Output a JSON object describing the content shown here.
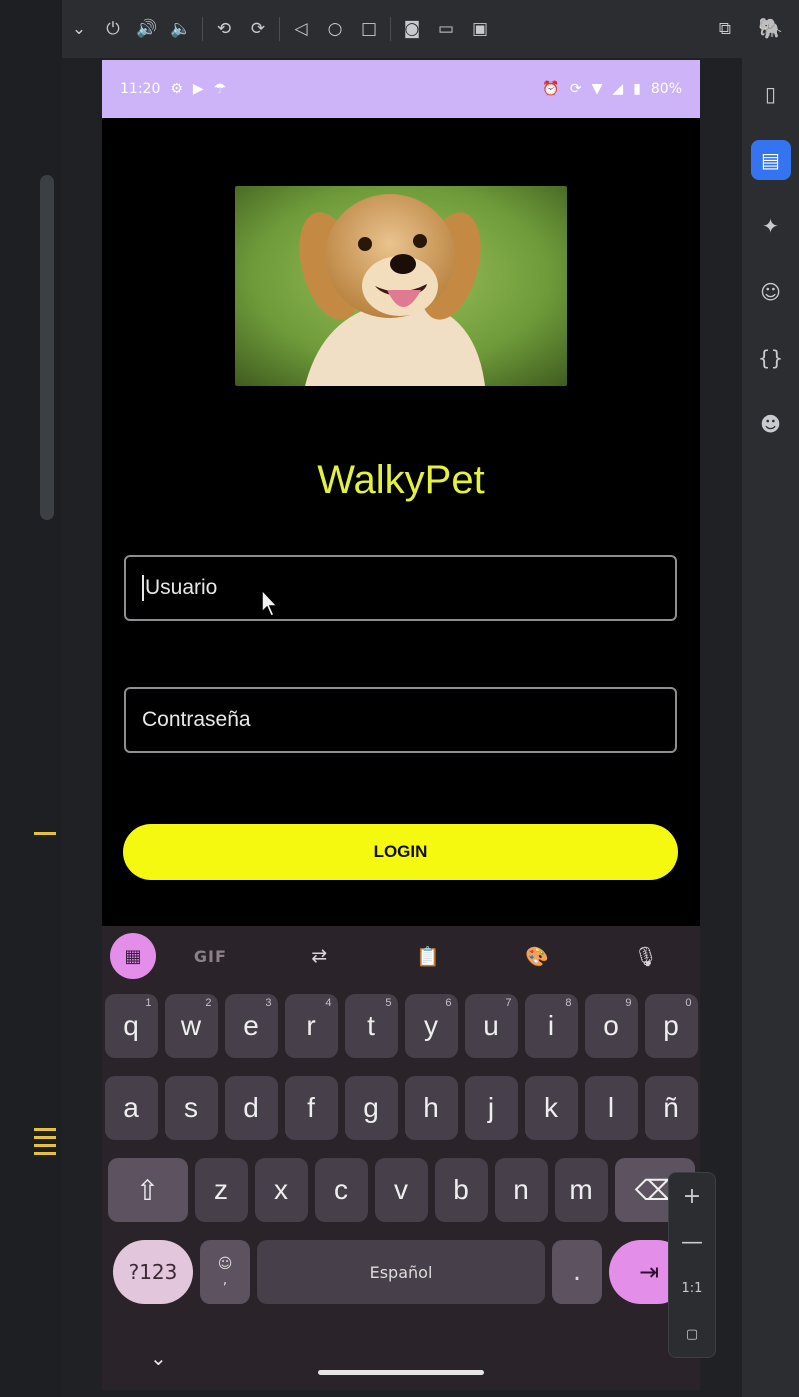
{
  "status_bar": {
    "time": "11:20",
    "battery": "80%",
    "left_icons": [
      "gear-icon",
      "youtube-icon",
      "cast-icon"
    ],
    "right_icons": [
      "alarm-icon",
      "sync-icon",
      "vibrate-icon",
      "wifi-icon",
      "signal-icon",
      "battery-icon"
    ]
  },
  "toolbar": {
    "icons": [
      "chevron-down",
      "power",
      "volume-up",
      "volume-down",
      "rotate-left",
      "rotate-right",
      "back",
      "home",
      "overview",
      "screenshot",
      "screenrecord",
      "extended-controls",
      "device-manager"
    ]
  },
  "app": {
    "title": "WalkyPet",
    "username_placeholder": "Usuario",
    "password_placeholder": "Contraseña",
    "login_label": "LOGIN"
  },
  "keyboard": {
    "tools": [
      "apps",
      "GIF",
      "translate",
      "clipboard",
      "theme",
      "mic"
    ],
    "gif_label": "GIF",
    "row1": [
      {
        "k": "q",
        "n": "1"
      },
      {
        "k": "w",
        "n": "2"
      },
      {
        "k": "e",
        "n": "3"
      },
      {
        "k": "r",
        "n": "4"
      },
      {
        "k": "t",
        "n": "5"
      },
      {
        "k": "y",
        "n": "6"
      },
      {
        "k": "u",
        "n": "7"
      },
      {
        "k": "i",
        "n": "8"
      },
      {
        "k": "o",
        "n": "9"
      },
      {
        "k": "p",
        "n": "0"
      }
    ],
    "row2": [
      "a",
      "s",
      "d",
      "f",
      "g",
      "h",
      "j",
      "k",
      "l",
      "ñ"
    ],
    "row3": [
      "z",
      "x",
      "c",
      "v",
      "b",
      "n",
      "m"
    ],
    "symbols_label": "?123",
    "space_label": "Español",
    "period_label": ".",
    "comma_label": ","
  },
  "zoom": {
    "plus": "+",
    "minus": "—",
    "ratio": "1:1"
  },
  "colors": {
    "accent_yellow": "#f4f90f",
    "title_yellow": "#e4f23d",
    "status_bar": "#cdb3f7",
    "keyboard_accent": "#e38ee9"
  }
}
